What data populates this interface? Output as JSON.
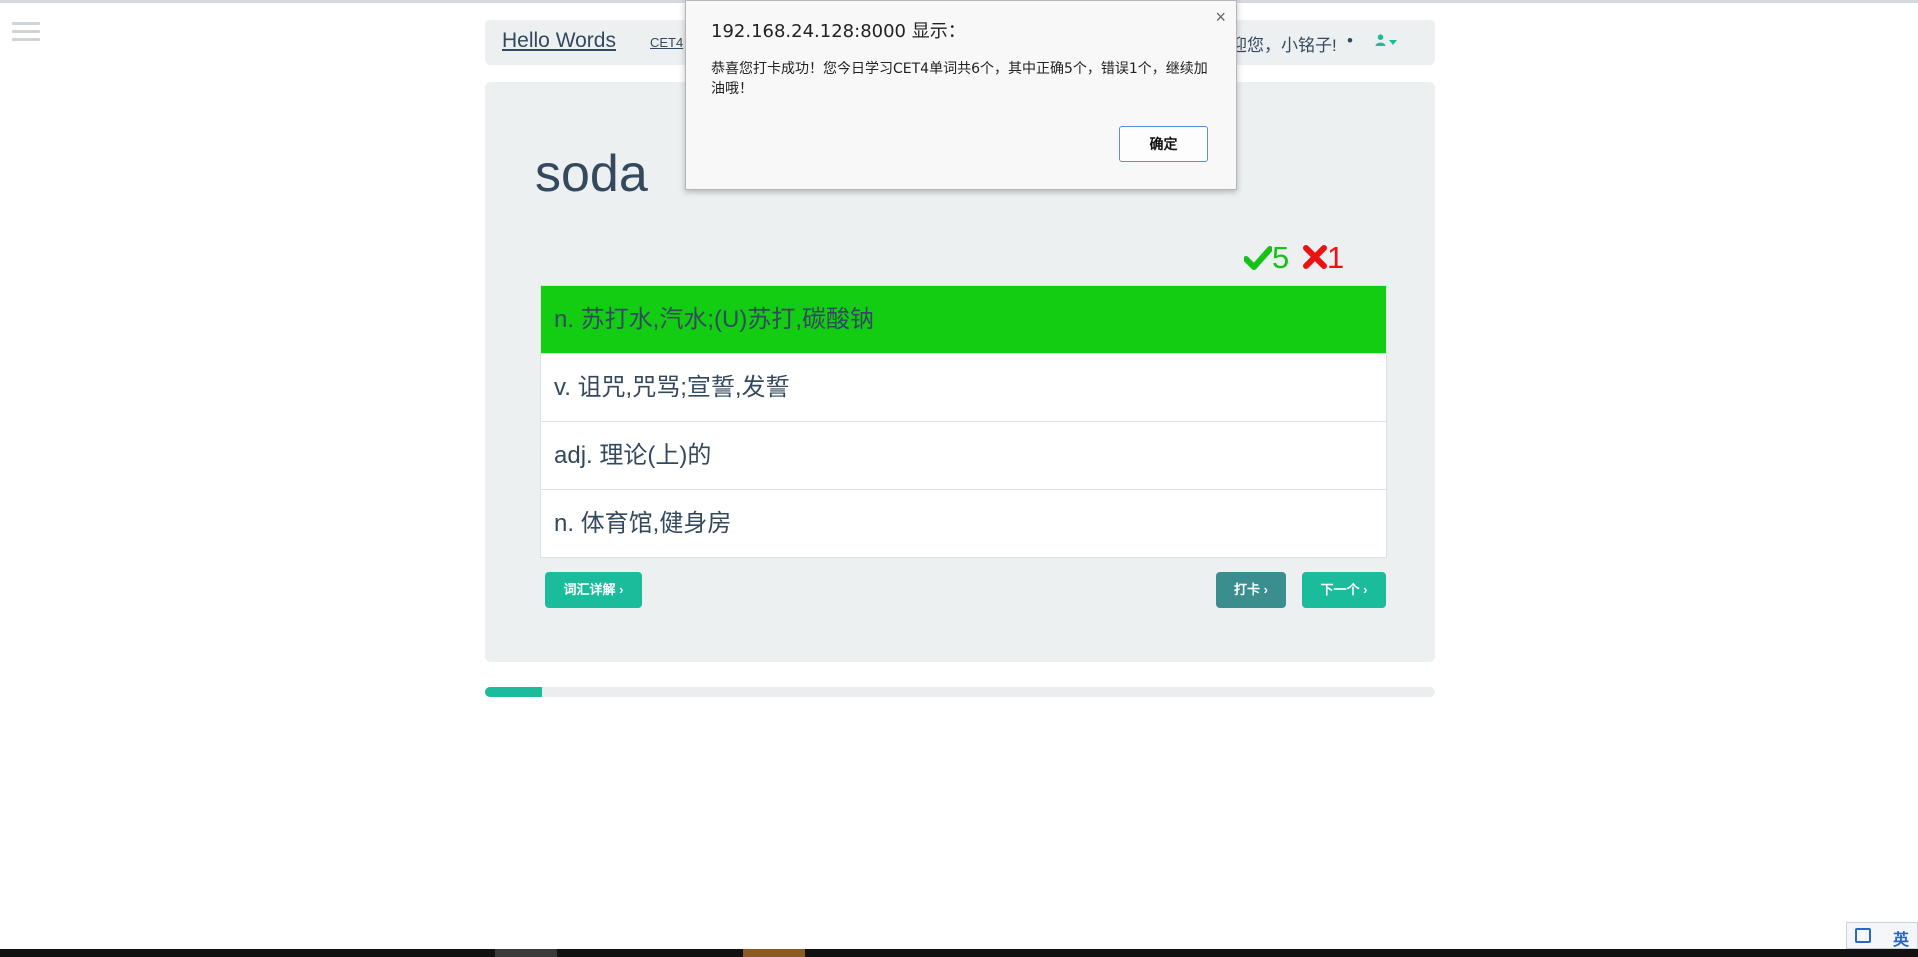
{
  "nav": {
    "brand": "Hello Words",
    "link": "CET4",
    "welcome": "迎您，小铭子!",
    "separator": "•",
    "user_icon": "user-icon"
  },
  "card": {
    "word": "soda",
    "correct_count": "5",
    "wrong_count": "1",
    "correct_icon": "check-icon",
    "wrong_icon": "cross-icon",
    "options": [
      "n. 苏打水,汽水;(U)苏打,碳酸钠",
      "v. 诅咒,咒骂;宣誓,发誓",
      "adj. 理论(上)的",
      "n. 体育馆,健身房"
    ],
    "selected_correct_option_index": 0,
    "buttons": {
      "detail": "词汇详解 ›",
      "checkin": "打卡 ›",
      "next": "下一个 ›"
    },
    "progress_percent": 6
  },
  "dialog": {
    "title": "192.168.24.128:8000 显示：",
    "message": "恭喜您打卡成功！您今日学习CET4单词共6个，其中正确5个，错误1个，继续加油哦！",
    "ok_label": "确定",
    "close_label": "×"
  },
  "colors": {
    "accent": "#1abc9c",
    "correct_bg": "#13cd13",
    "correct_text": "#16c216",
    "wrong_text": "#ee1111",
    "panel_bg": "#ecf0f1"
  },
  "system": {
    "ime_label": "英"
  }
}
